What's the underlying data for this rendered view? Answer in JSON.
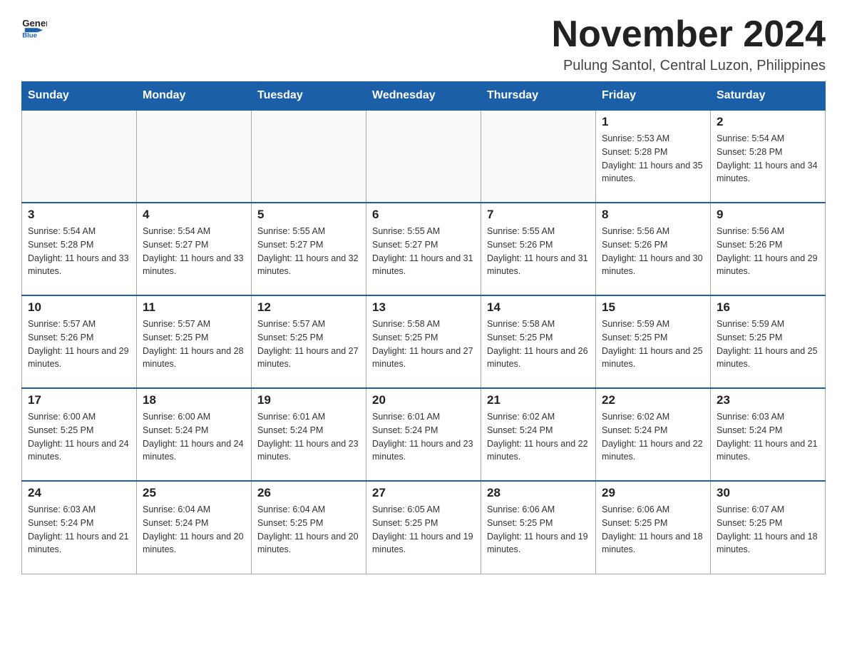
{
  "header": {
    "logo_general": "General",
    "logo_blue": "Blue",
    "month_title": "November 2024",
    "subtitle": "Pulung Santol, Central Luzon, Philippines"
  },
  "days_of_week": [
    "Sunday",
    "Monday",
    "Tuesday",
    "Wednesday",
    "Thursday",
    "Friday",
    "Saturday"
  ],
  "weeks": [
    [
      {
        "day": "",
        "info": ""
      },
      {
        "day": "",
        "info": ""
      },
      {
        "day": "",
        "info": ""
      },
      {
        "day": "",
        "info": ""
      },
      {
        "day": "",
        "info": ""
      },
      {
        "day": "1",
        "info": "Sunrise: 5:53 AM\nSunset: 5:28 PM\nDaylight: 11 hours and 35 minutes."
      },
      {
        "day": "2",
        "info": "Sunrise: 5:54 AM\nSunset: 5:28 PM\nDaylight: 11 hours and 34 minutes."
      }
    ],
    [
      {
        "day": "3",
        "info": "Sunrise: 5:54 AM\nSunset: 5:28 PM\nDaylight: 11 hours and 33 minutes."
      },
      {
        "day": "4",
        "info": "Sunrise: 5:54 AM\nSunset: 5:27 PM\nDaylight: 11 hours and 33 minutes."
      },
      {
        "day": "5",
        "info": "Sunrise: 5:55 AM\nSunset: 5:27 PM\nDaylight: 11 hours and 32 minutes."
      },
      {
        "day": "6",
        "info": "Sunrise: 5:55 AM\nSunset: 5:27 PM\nDaylight: 11 hours and 31 minutes."
      },
      {
        "day": "7",
        "info": "Sunrise: 5:55 AM\nSunset: 5:26 PM\nDaylight: 11 hours and 31 minutes."
      },
      {
        "day": "8",
        "info": "Sunrise: 5:56 AM\nSunset: 5:26 PM\nDaylight: 11 hours and 30 minutes."
      },
      {
        "day": "9",
        "info": "Sunrise: 5:56 AM\nSunset: 5:26 PM\nDaylight: 11 hours and 29 minutes."
      }
    ],
    [
      {
        "day": "10",
        "info": "Sunrise: 5:57 AM\nSunset: 5:26 PM\nDaylight: 11 hours and 29 minutes."
      },
      {
        "day": "11",
        "info": "Sunrise: 5:57 AM\nSunset: 5:25 PM\nDaylight: 11 hours and 28 minutes."
      },
      {
        "day": "12",
        "info": "Sunrise: 5:57 AM\nSunset: 5:25 PM\nDaylight: 11 hours and 27 minutes."
      },
      {
        "day": "13",
        "info": "Sunrise: 5:58 AM\nSunset: 5:25 PM\nDaylight: 11 hours and 27 minutes."
      },
      {
        "day": "14",
        "info": "Sunrise: 5:58 AM\nSunset: 5:25 PM\nDaylight: 11 hours and 26 minutes."
      },
      {
        "day": "15",
        "info": "Sunrise: 5:59 AM\nSunset: 5:25 PM\nDaylight: 11 hours and 25 minutes."
      },
      {
        "day": "16",
        "info": "Sunrise: 5:59 AM\nSunset: 5:25 PM\nDaylight: 11 hours and 25 minutes."
      }
    ],
    [
      {
        "day": "17",
        "info": "Sunrise: 6:00 AM\nSunset: 5:25 PM\nDaylight: 11 hours and 24 minutes."
      },
      {
        "day": "18",
        "info": "Sunrise: 6:00 AM\nSunset: 5:24 PM\nDaylight: 11 hours and 24 minutes."
      },
      {
        "day": "19",
        "info": "Sunrise: 6:01 AM\nSunset: 5:24 PM\nDaylight: 11 hours and 23 minutes."
      },
      {
        "day": "20",
        "info": "Sunrise: 6:01 AM\nSunset: 5:24 PM\nDaylight: 11 hours and 23 minutes."
      },
      {
        "day": "21",
        "info": "Sunrise: 6:02 AM\nSunset: 5:24 PM\nDaylight: 11 hours and 22 minutes."
      },
      {
        "day": "22",
        "info": "Sunrise: 6:02 AM\nSunset: 5:24 PM\nDaylight: 11 hours and 22 minutes."
      },
      {
        "day": "23",
        "info": "Sunrise: 6:03 AM\nSunset: 5:24 PM\nDaylight: 11 hours and 21 minutes."
      }
    ],
    [
      {
        "day": "24",
        "info": "Sunrise: 6:03 AM\nSunset: 5:24 PM\nDaylight: 11 hours and 21 minutes."
      },
      {
        "day": "25",
        "info": "Sunrise: 6:04 AM\nSunset: 5:24 PM\nDaylight: 11 hours and 20 minutes."
      },
      {
        "day": "26",
        "info": "Sunrise: 6:04 AM\nSunset: 5:25 PM\nDaylight: 11 hours and 20 minutes."
      },
      {
        "day": "27",
        "info": "Sunrise: 6:05 AM\nSunset: 5:25 PM\nDaylight: 11 hours and 19 minutes."
      },
      {
        "day": "28",
        "info": "Sunrise: 6:06 AM\nSunset: 5:25 PM\nDaylight: 11 hours and 19 minutes."
      },
      {
        "day": "29",
        "info": "Sunrise: 6:06 AM\nSunset: 5:25 PM\nDaylight: 11 hours and 18 minutes."
      },
      {
        "day": "30",
        "info": "Sunrise: 6:07 AM\nSunset: 5:25 PM\nDaylight: 11 hours and 18 minutes."
      }
    ]
  ]
}
